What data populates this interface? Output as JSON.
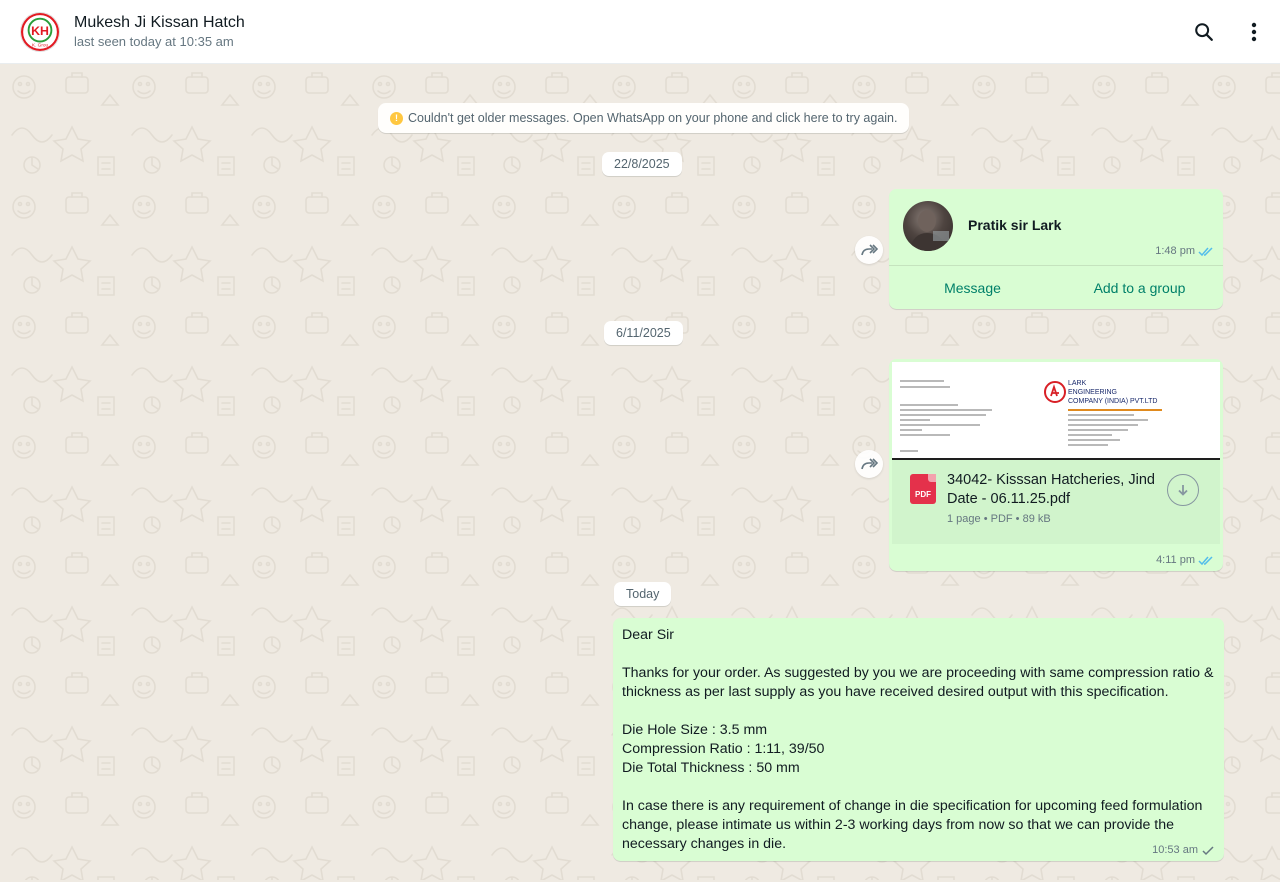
{
  "header": {
    "contact_name": "Mukesh Ji Kissan Hatch",
    "last_seen": "last seen today at 10:35 am",
    "avatar_logo": "KH",
    "avatar_subtext": "K. Grou"
  },
  "notice": {
    "text": "Couldn't get older messages. Open WhatsApp on your phone and click here to try again."
  },
  "dates": {
    "first": "22/8/2025",
    "second": "6/11/2025",
    "third": "Today"
  },
  "contact_card": {
    "name": "Pratik sir Lark",
    "time": "1:48 pm",
    "message_button": "Message",
    "add_group_button": "Add to a group"
  },
  "document": {
    "file_name": "34042- Kisssan Hatcheries, Jind Date - 06.11.25.pdf",
    "file_meta": "1 page • PDF • 89 kB",
    "icon_label": "PDF",
    "time": "4:11 pm",
    "preview": {
      "company_line1": "LARK",
      "company_line2": "ENGINEERING",
      "company_line3": "COMPANY (INDIA) PVT.LTD"
    }
  },
  "message": {
    "lines": [
      "Dear Sir",
      "",
      "Thanks for your order. As suggested by you we are proceeding with same compression ratio & thickness as per last supply as you have received desired output with this specification.",
      "",
      "Die Hole Size : 3.5 mm",
      "Compression Ratio : 1:11, 39/50",
      "Die Total Thickness : 50 mm",
      "",
      "In case there is any requirement of change in die specification for upcoming feed formulation change, please intimate us within 2-3 working days from now so that we can provide the necessary changes in die."
    ],
    "time": "10:53 am"
  },
  "colors": {
    "bubble_out": "#d9fdd3",
    "chat_bg": "#efeae2",
    "accent": "#008069",
    "read_tick": "#53bdeb"
  }
}
